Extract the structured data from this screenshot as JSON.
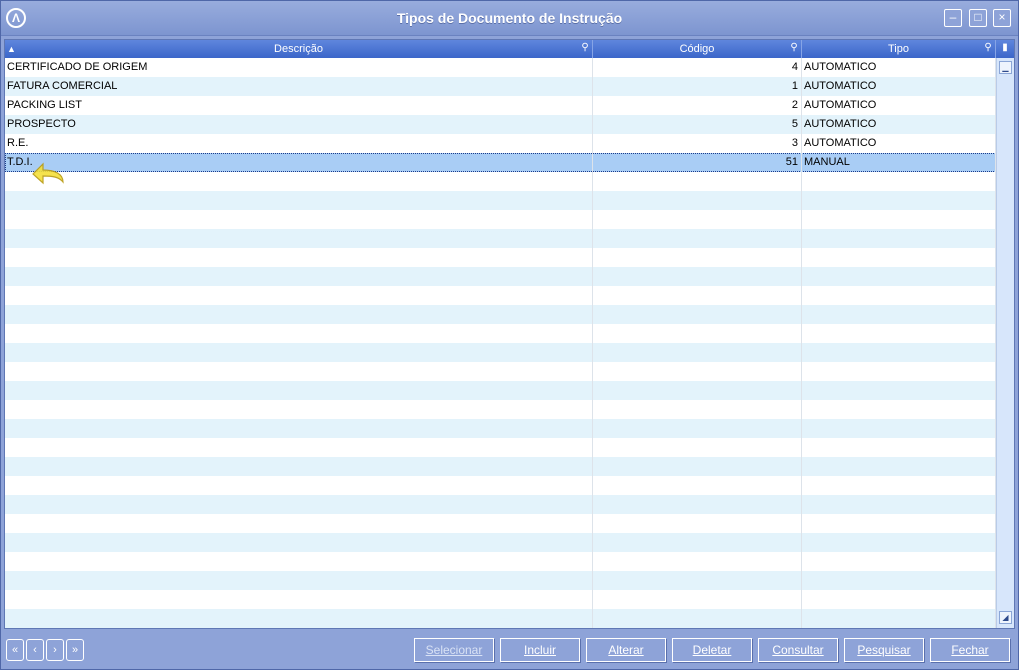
{
  "window": {
    "title": "Tipos de Documento de Instrução",
    "controls": {
      "minimize": "–",
      "maximize": "□",
      "close": "×"
    }
  },
  "grid": {
    "columns": [
      {
        "label": "Descrição"
      },
      {
        "label": "Código"
      },
      {
        "label": "Tipo"
      }
    ],
    "rows": [
      {
        "descricao": "CERTIFICADO DE ORIGEM",
        "codigo": "4",
        "tipo": "AUTOMATICO"
      },
      {
        "descricao": "FATURA COMERCIAL",
        "codigo": "1",
        "tipo": "AUTOMATICO"
      },
      {
        "descricao": "PACKING LIST",
        "codigo": "2",
        "tipo": "AUTOMATICO"
      },
      {
        "descricao": "PROSPECTO",
        "codigo": "5",
        "tipo": "AUTOMATICO"
      },
      {
        "descricao": "R.E.",
        "codigo": "3",
        "tipo": "AUTOMATICO"
      },
      {
        "descricao": "T.D.I.",
        "codigo": "51",
        "tipo": "MANUAL"
      }
    ],
    "selected_row": 5,
    "empty_rows": 24
  },
  "nav": [
    "«",
    "‹",
    "›",
    "»"
  ],
  "buttons": {
    "selecionar": "Selecionar",
    "incluir": "Incluir",
    "alterar": "Alterar",
    "deletar": "Deletar",
    "consultar": "Consultar",
    "pesquisar": "Pesquisar",
    "fechar": "Fechar"
  },
  "colors": {
    "titlebar": "#8ea3d8",
    "header": "#3b66c9",
    "row_alt": "#e3f3fb",
    "selected_row": "#a9cdf5"
  }
}
